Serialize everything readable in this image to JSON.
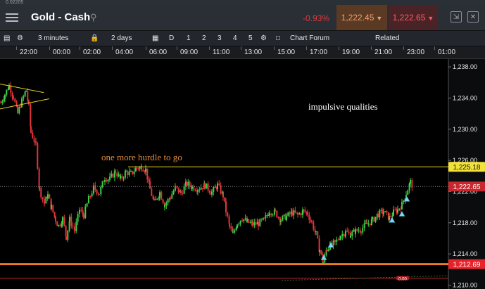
{
  "status_text": "0.02205",
  "header": {
    "instrument": "Gold - Cash",
    "change": "-0.93%",
    "sell_price": "1,222.45",
    "buy_price": "1,222.65"
  },
  "toolbar": {
    "interval": "3 minutes",
    "range": "2 days",
    "draw_label": "D",
    "layouts": [
      "1",
      "2",
      "3",
      "4",
      "5"
    ],
    "forum": "Chart Forum",
    "related": "Related"
  },
  "time_labels": [
    "22:00",
    "00:00",
    "02:00",
    "04:00",
    "06:00",
    "09:00",
    "11:00",
    "13:00",
    "15:00",
    "17:00",
    "19:00",
    "21:00",
    "23:00",
    "01:00"
  ],
  "annotations": {
    "impulsive": "impulsive qualities",
    "hurdle": "one more hurdle to go"
  },
  "markers": {
    "resistance": "1,225.18",
    "current": "1,222.65",
    "support": "1,212.69",
    "bottom_red": "0.00"
  },
  "colors": {
    "background": "#000000",
    "resistance_line": "#e6d21e",
    "support_line": "#e67e22",
    "current_tag": "#c8282d",
    "up_candle": "#3ecf45",
    "down_candle": "#e3343a",
    "price_text": "#e8e8e8"
  },
  "chart_data": {
    "type": "candlestick",
    "x_labels": [
      "22:00",
      "00:00",
      "02:00",
      "04:00",
      "06:00",
      "09:00",
      "11:00",
      "13:00",
      "15:00",
      "17:00",
      "19:00",
      "21:00",
      "23:00",
      "01:00"
    ],
    "y_ticks": [
      1210,
      1214,
      1218,
      1222,
      1226,
      1230,
      1234,
      1238
    ],
    "y_tick_labels": [
      "1,210.00",
      "1,214.00",
      "1,218.00",
      "1,222.00",
      "1,226.00",
      "1,230.00",
      "1,234.00",
      "1,238.00"
    ],
    "ylim": [
      1209.5,
      1239
    ],
    "path": [
      [
        0,
        1233.4
      ],
      [
        6,
        1234.5
      ],
      [
        12,
        1235.6
      ],
      [
        18,
        1234.2
      ],
      [
        24,
        1232.0
      ],
      [
        30,
        1233.6
      ],
      [
        36,
        1235.0
      ],
      [
        40,
        1232.8
      ],
      [
        43,
        1229.6
      ],
      [
        50,
        1228.0
      ],
      [
        55,
        1222.3
      ],
      [
        62,
        1220.5
      ],
      [
        67,
        1221.5
      ],
      [
        72,
        1220.0
      ],
      [
        78,
        1218.4
      ],
      [
        82,
        1217.6
      ],
      [
        88,
        1218.5
      ],
      [
        93,
        1216.2
      ],
      [
        98,
        1218.4
      ],
      [
        105,
        1217.0
      ],
      [
        112,
        1219.6
      ],
      [
        118,
        1219.0
      ],
      [
        125,
        1221.0
      ],
      [
        132,
        1222.5
      ],
      [
        140,
        1221.8
      ],
      [
        148,
        1223.8
      ],
      [
        155,
        1223.6
      ],
      [
        163,
        1224.6
      ],
      [
        170,
        1223.6
      ],
      [
        178,
        1224.5
      ],
      [
        185,
        1224.3
      ],
      [
        193,
        1225.0
      ],
      [
        200,
        1225.2
      ],
      [
        206,
        1224.8
      ],
      [
        212,
        1222.3
      ],
      [
        218,
        1220.5
      ],
      [
        226,
        1221.9
      ],
      [
        233,
        1220.3
      ],
      [
        241,
        1221.3
      ],
      [
        248,
        1222.5
      ],
      [
        256,
        1221.8
      ],
      [
        264,
        1223.0
      ],
      [
        272,
        1222.6
      ],
      [
        280,
        1222.4
      ],
      [
        290,
        1222.8
      ],
      [
        300,
        1221.9
      ],
      [
        308,
        1222.8
      ],
      [
        316,
        1221.5
      ],
      [
        320,
        1219.5
      ],
      [
        325,
        1217.5
      ],
      [
        330,
        1216.5
      ],
      [
        336,
        1218.0
      ],
      [
        343,
        1218.6
      ],
      [
        350,
        1218.1
      ],
      [
        358,
        1217.8
      ],
      [
        366,
        1217.9
      ],
      [
        374,
        1218.3
      ],
      [
        382,
        1219.5
      ],
      [
        390,
        1219.3
      ],
      [
        398,
        1218.4
      ],
      [
        406,
        1218.8
      ],
      [
        414,
        1219.3
      ],
      [
        422,
        1219.0
      ],
      [
        430,
        1219.5
      ],
      [
        436,
        1219.2
      ],
      [
        442,
        1218.0
      ],
      [
        448,
        1216.5
      ],
      [
        453,
        1214.5
      ],
      [
        458,
        1212.9
      ],
      [
        463,
        1214.6
      ],
      [
        468,
        1215.0
      ],
      [
        475,
        1215.4
      ],
      [
        483,
        1216.4
      ],
      [
        490,
        1216.8
      ],
      [
        497,
        1216.5
      ],
      [
        504,
        1216.9
      ],
      [
        512,
        1217.2
      ],
      [
        520,
        1217.8
      ],
      [
        528,
        1218.3
      ],
      [
        536,
        1219.1
      ],
      [
        544,
        1219.4
      ],
      [
        552,
        1218.6
      ],
      [
        558,
        1219.3
      ],
      [
        564,
        1219.7
      ],
      [
        570,
        1220.3
      ],
      [
        576,
        1221.8
      ],
      [
        582,
        1223.2
      ],
      [
        586,
        1222.6
      ]
    ],
    "lines": {
      "resistance": 1225.18,
      "current": 1222.65,
      "support": 1212.69,
      "baseline": 1210.9
    },
    "wedge": {
      "upper": [
        [
          0,
          1235.8
        ],
        [
          62,
          1234.7
        ]
      ],
      "lower": [
        [
          0,
          1232.6
        ],
        [
          70,
          1233.9
        ]
      ]
    },
    "arrows": [
      [
        460,
        1213.6
      ],
      [
        470,
        1215.2
      ],
      [
        557,
        1218.4
      ],
      [
        571,
        1219.2
      ],
      [
        578,
        1221.1
      ]
    ],
    "note_impulsive": [
      438,
      1232.5
    ],
    "note_hurdle": [
      144,
      1226.0
    ]
  }
}
